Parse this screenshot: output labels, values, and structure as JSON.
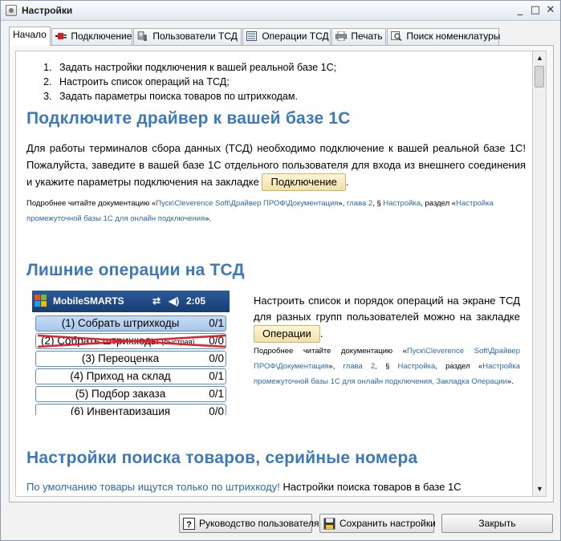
{
  "window": {
    "title": "Настройки",
    "controls": [
      "_",
      "□",
      "✕"
    ]
  },
  "tabs": [
    {
      "label": "Начало",
      "active": true
    },
    {
      "label": "Подключение"
    },
    {
      "label": "Пользователи ТСД"
    },
    {
      "label": "Операции ТСД"
    },
    {
      "label": "Печать"
    },
    {
      "label": "Поиск номенклатуры"
    }
  ],
  "steps": [
    "Задать настройки подключения к вашей реальной базе 1С;",
    "Настроить список операций на ТСД;",
    "Задать параметры поиска товаров по штрихкодам."
  ],
  "section1": {
    "heading": "Подключите драйвер к вашей базе 1С",
    "text": "Для работы терминалов сбора данных (ТСД) необходимо подключение к вашей реальной базе 1С! Пожалуйста, заведите в вашей базе 1С отдельного пользователя для входа из внешнего соединения и укажите параметры подключения на закладке",
    "button": "Подключение",
    "end": ".",
    "note_a": "Подробнее читайте документацию «",
    "note_link1": "Пуск\\Cleverence Soft\\Драйвер ПРОФ\\Документация",
    "note_b": "», ",
    "note_link2": "глава 2",
    "note_c": ", § ",
    "note_link3": "Настройка",
    "note_d": ", раздел «",
    "note_link4": "Настройка промежуточной базы 1С для онлайн подключения",
    "note_e": "»."
  },
  "section2": {
    "heading": "Лишние операции на ТСД",
    "text": "Настроить список и порядок операций на экране ТСД для разных групп пользователей можно на закладке",
    "button": "Операции",
    "end": ".",
    "note_a": "Подробнее читайте документацию «",
    "note_link1": "Пуск\\Cleverence Soft\\Драйвер ПРОФ\\Документация",
    "note_b": "», ",
    "note_link2": "глава 2",
    "note_c": ", § ",
    "note_link3": "Настройка",
    "note_d": ", раздел «",
    "note_link4": "Настройка промежуточной базы 1С для онлайн подключения, Закладка Операции",
    "note_e": "»."
  },
  "mobile": {
    "app": "MobileSMARTS",
    "time": "2:05",
    "rows": [
      {
        "label": "(1) Собрать штрихкоды",
        "count": "0/1"
      },
      {
        "label": "(2) Собрать штрихкоды",
        "suffix": "(быстрая)",
        "count": "0/0"
      },
      {
        "label": "(3) Переоценка",
        "count": "0/0"
      },
      {
        "label": "(4) Приход на склад",
        "count": "0/1"
      },
      {
        "label": "(5) Подбор заказа",
        "count": "0/1"
      },
      {
        "label": "(6) Инвентаризация",
        "count": "0/0"
      }
    ]
  },
  "section3": {
    "heading": "Настройки поиска товаров, серийные номера",
    "text_link": "По умолчанию товары ищутся только по штрихкоду!",
    "text": " Настройки поиска товаров в базе 1С"
  },
  "buttons": {
    "help": "Руководство пользователя",
    "save": "Сохранить настройки",
    "close": "Закрыть"
  },
  "colors": {
    "heading": "#3d79b8",
    "link": "#2c6aa4",
    "strike": "#e0202a"
  }
}
